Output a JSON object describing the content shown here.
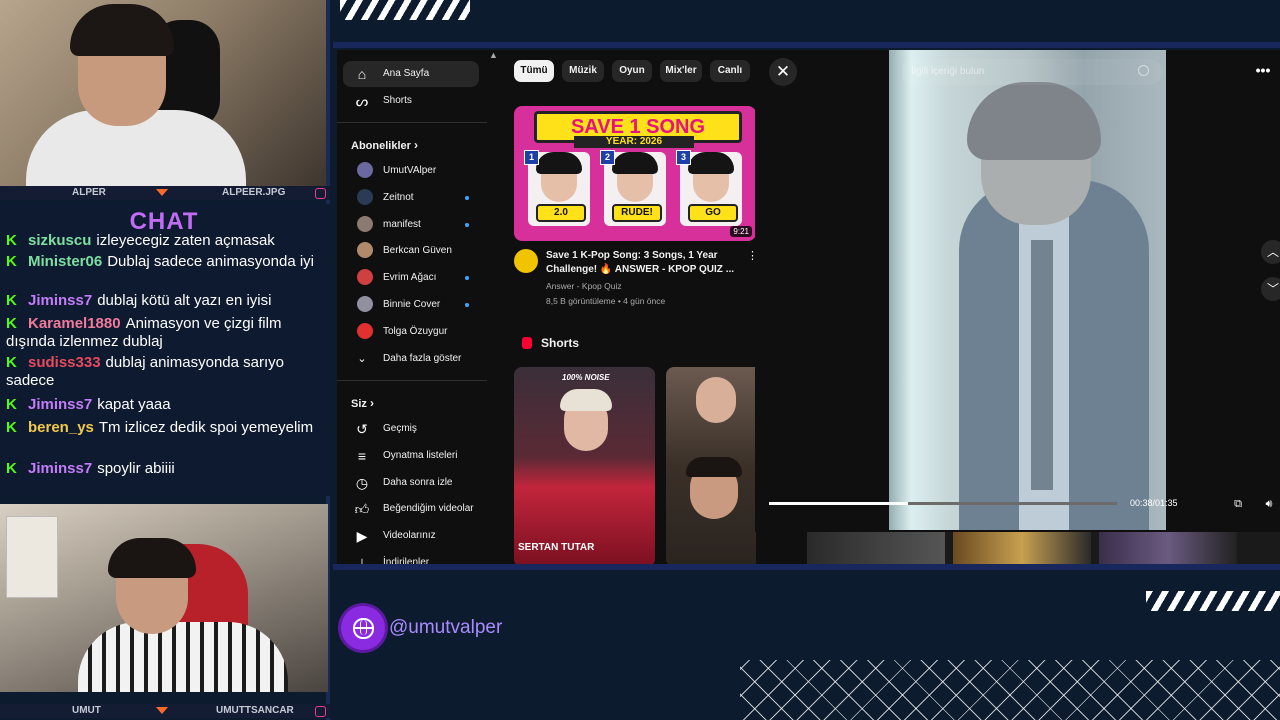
{
  "streamer_cam": {
    "left_label": "ALPER",
    "right_label": "ALPEER.JPG"
  },
  "guest_cam": {
    "left_label": "UMUT",
    "right_label": "UMUTTSANCAR"
  },
  "chat": {
    "title": "CHAT",
    "messages": [
      {
        "user": "sizkuscu",
        "color": "#7be0a0",
        "text": "izleyecegiz zaten açmasak"
      },
      {
        "user": "Minister06",
        "color": "#7be0a0",
        "text": "Dublaj sadece animasyonda iyi"
      },
      {
        "user": "Jiminss7",
        "color": "#c27cf7",
        "text": "dublaj kötü alt yazı en iyisi"
      },
      {
        "user": "Karamel1880",
        "color": "#f27a9c",
        "text": "Animasyon ve çizgi film dışında izlenmez dublaj"
      },
      {
        "user": "sudiss333",
        "color": "#e84a5f",
        "text": "dublaj animasyonda sarıyo sadece"
      },
      {
        "user": "Jiminss7",
        "color": "#c27cf7",
        "text": "kapat yaaa"
      },
      {
        "user": "beren_ys",
        "color": "#f2c94c",
        "text": "Tm izlicez dedik spoi yemeyelim"
      },
      {
        "user": "Jiminss7",
        "color": "#c27cf7",
        "text": "spoylir abiiii"
      }
    ]
  },
  "youtube": {
    "sidebar": {
      "main": [
        {
          "label": "Ana Sayfa",
          "icon": "home-icon"
        },
        {
          "label": "Shorts",
          "icon": "shorts-icon"
        }
      ],
      "subscriptions_title": "Abonelikler",
      "subscriptions": [
        {
          "label": "UmutVAlper",
          "color": "#6a6aa0",
          "dot": false
        },
        {
          "label": "Zeitnot",
          "color": "#2b3a55",
          "dot": true
        },
        {
          "label": "manifest",
          "color": "#8a7a70",
          "dot": true
        },
        {
          "label": "Berkcan Güven",
          "color": "#b08a6a",
          "dot": false
        },
        {
          "label": "Evrim Ağacı",
          "color": "#d04040",
          "dot": true
        },
        {
          "label": "Binnie Cover",
          "color": "#9090a0",
          "dot": true
        },
        {
          "label": "Tolga Özuygur",
          "color": "#e03030",
          "dot": false
        }
      ],
      "show_more": "Daha fazla göster",
      "you_title": "Siz",
      "you": [
        {
          "label": "Geçmiş",
          "icon": "history-icon"
        },
        {
          "label": "Oynatma listeleri",
          "icon": "playlist-icon"
        },
        {
          "label": "Daha sonra izle",
          "icon": "watch-later-icon"
        },
        {
          "label": "Beğendiğim videolar",
          "icon": "like-icon"
        },
        {
          "label": "Videolarınız",
          "icon": "your-videos-icon"
        },
        {
          "label": "İndirilenler",
          "icon": "download-icon"
        }
      ]
    },
    "chips": [
      "Tümü",
      "Müzik",
      "Oyun",
      "Mix'ler",
      "Canlı"
    ],
    "video": {
      "thumbnail_title": "SAVE 1 SONG",
      "thumbnail_year": "YEAR: 2026",
      "thumbnail_tags": [
        "2.0",
        "RUDE!",
        "GO"
      ],
      "thumbnail_numbers": [
        "1",
        "2",
        "3"
      ],
      "duration": "9:21",
      "title": "Save 1 K-Pop Song: 3 Songs, 1 Year Challenge! 🔥 ANSWER - KPOP QUIZ ...",
      "channel": "Answer - Kpop Quiz",
      "meta": "8,5 B görüntüleme • 4 gün önce"
    },
    "shorts_title": "Shorts",
    "shorts": [
      {
        "caption": "SERTAN TUTAR",
        "badge": "100% NOISE"
      },
      {
        "caption": ""
      }
    ]
  },
  "shorts_player": {
    "search_placeholder": "İlgili içeriği bulun",
    "time": "00:38/01:35",
    "progress": 0.4
  },
  "social": {
    "handle": "@umutvalper"
  }
}
